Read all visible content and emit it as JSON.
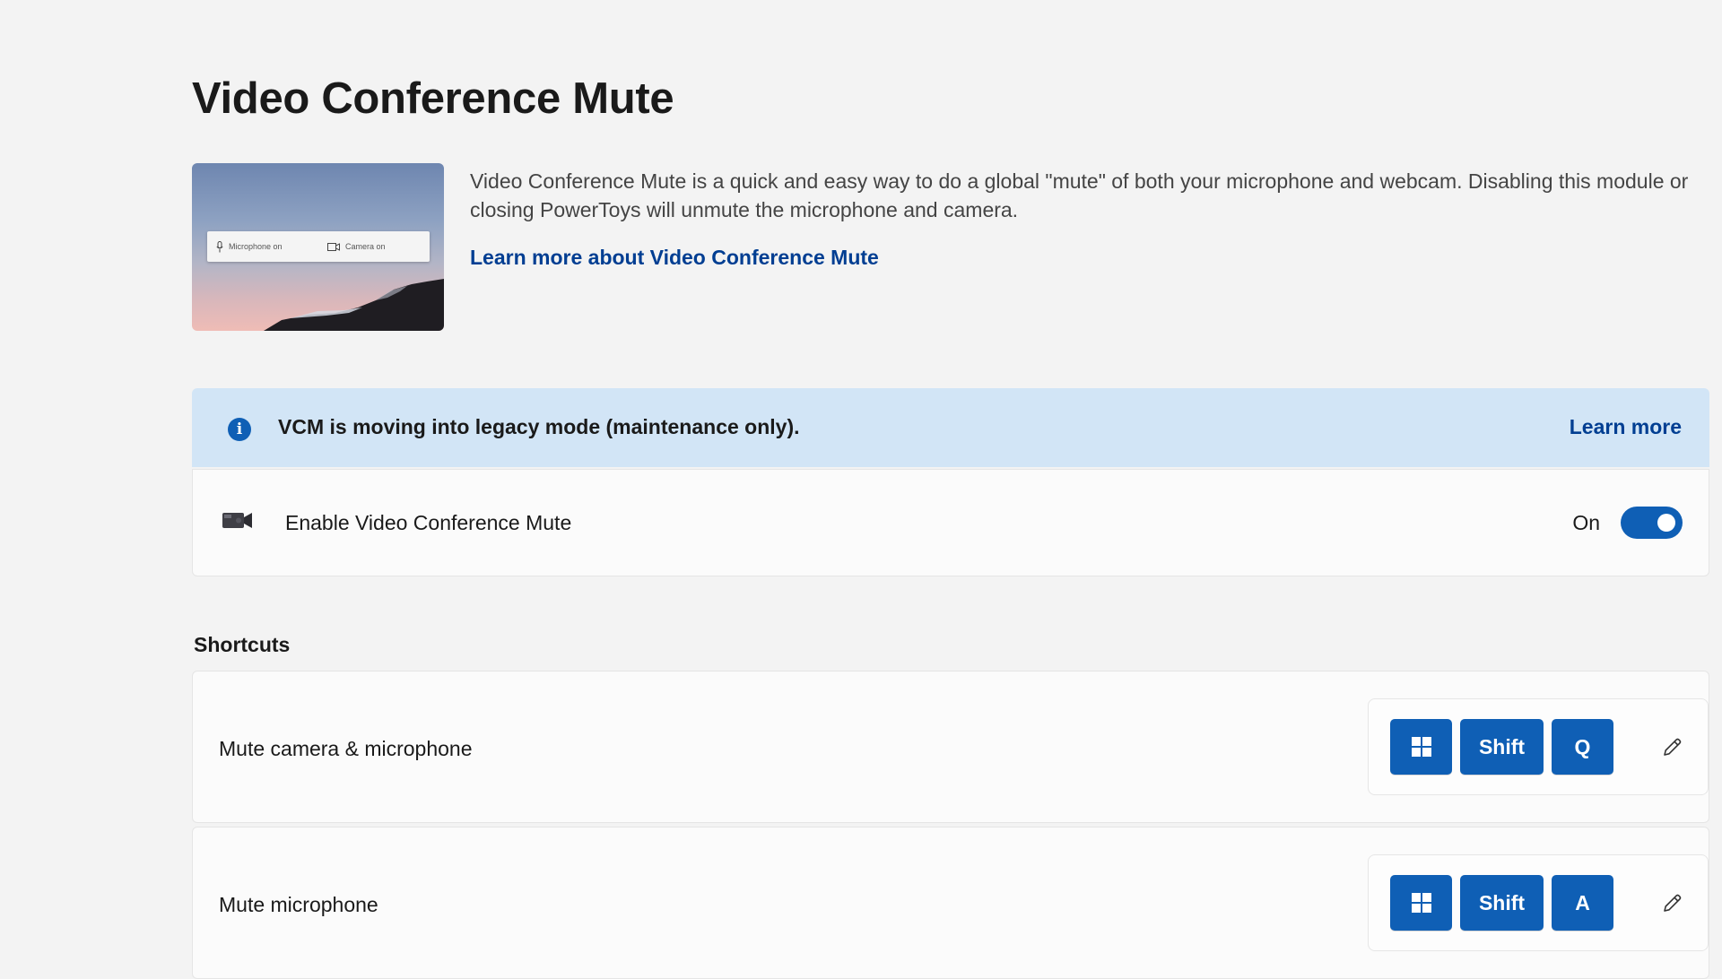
{
  "page": {
    "title": "Video Conference Mute"
  },
  "hero": {
    "description": "Video Conference Mute is a quick and easy way to do a global \"mute\" of both your microphone and webcam. Disabling this module or closing PowerToys will unmute the microphone and camera.",
    "link_label": "Learn more about Video Conference Mute",
    "image": {
      "microphone_label": "Microphone on",
      "camera_label": "Camera on"
    }
  },
  "infobar": {
    "icon": "info-icon",
    "message": "VCM is moving into legacy mode (maintenance only).",
    "link_label": "Learn more"
  },
  "enable": {
    "icon": "video-camera-icon",
    "label": "Enable Video Conference Mute",
    "state_label": "On",
    "enabled": true
  },
  "shortcuts": {
    "section_title": "Shortcuts",
    "items": [
      {
        "label": "Mute camera & microphone",
        "keys": [
          "Win",
          "Shift",
          "Q"
        ]
      },
      {
        "label": "Mute microphone",
        "keys": [
          "Win",
          "Shift",
          "A"
        ]
      }
    ]
  },
  "colors": {
    "accent": "#0f5fb5",
    "link": "#003e92",
    "info_background": "#d2e5f6",
    "page_background": "#f3f3f3",
    "card_background": "#fbfbfb"
  }
}
